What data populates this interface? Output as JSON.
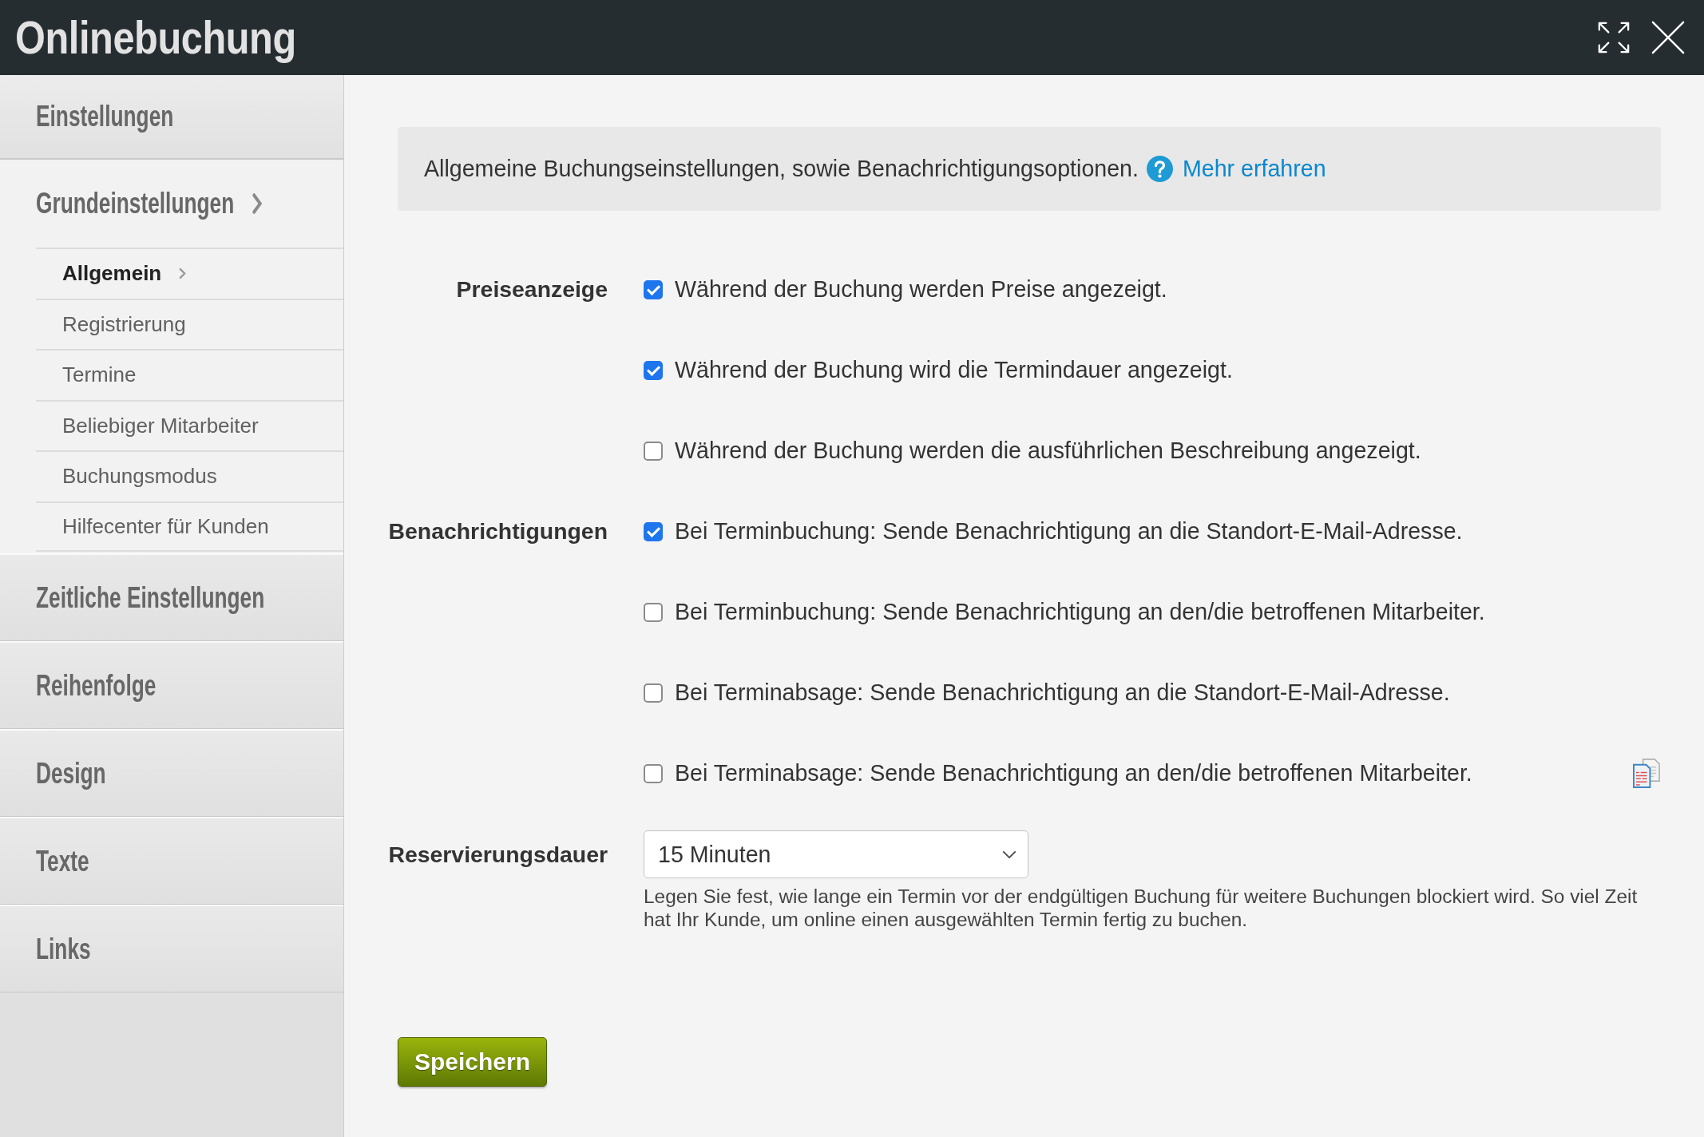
{
  "window": {
    "title": "Onlinebuchung"
  },
  "sidebar": {
    "heading": "Einstellungen",
    "items": [
      {
        "label": "Grundeinstellungen",
        "selected": true,
        "children": [
          {
            "label": "Allgemein",
            "selected": true
          },
          {
            "label": "Registrierung",
            "selected": false
          },
          {
            "label": "Termine",
            "selected": false
          },
          {
            "label": "Beliebiger Mitarbeiter",
            "selected": false
          },
          {
            "label": "Buchungsmodus",
            "selected": false
          },
          {
            "label": "Hilfecenter für Kunden",
            "selected": false
          }
        ]
      },
      {
        "label": "Zeitliche Einstellungen",
        "selected": false
      },
      {
        "label": "Reihenfolge",
        "selected": false
      },
      {
        "label": "Design",
        "selected": false
      },
      {
        "label": "Texte",
        "selected": false
      },
      {
        "label": "Links",
        "selected": false
      }
    ]
  },
  "info": {
    "text": "Allgemeine Buchungseinstellungen, sowie Benachrichtigungsoptionen.",
    "link": "Mehr erfahren"
  },
  "fields": [
    {
      "kind": "checkboxes",
      "label": "Preiseanzeige",
      "options": [
        {
          "label": "Während der Buchung werden Preise angezeigt.",
          "checked": true
        },
        {
          "label": "Während der Buchung wird die Termindauer angezeigt.",
          "checked": true
        },
        {
          "label": "Während der Buchung werden die ausführlichen Beschreibung angezeigt.",
          "checked": false
        }
      ]
    },
    {
      "kind": "checkboxes",
      "label": "Benachrichtigungen",
      "options": [
        {
          "label": "Bei Terminbuchung: Sende Benachrichtigung an die Standort-E-Mail-Adresse.",
          "checked": true
        },
        {
          "label": "Bei Terminbuchung: Sende Benachrichtigung an den/die betroffenen Mitarbeiter.",
          "checked": false
        },
        {
          "label": "Bei Terminabsage: Sende Benachrichtigung an die Standort-E-Mail-Adresse.",
          "checked": false
        },
        {
          "label": "Bei Terminabsage: Sende Benachrichtigung an den/die betroffenen Mitarbeiter.",
          "checked": false
        }
      ]
    },
    {
      "kind": "select",
      "label": "Reservierungsdauer",
      "value": "15 Minuten",
      "hint": "Legen Sie fest, wie lange ein Termin vor der endgültigen Buchung für weitere Buchungen blockiert wird. So viel Zeit hat Ihr Kunde, um online einen ausgewählten Termin fertig zu buchen."
    }
  ],
  "save_button": {
    "label": "Speichern"
  }
}
